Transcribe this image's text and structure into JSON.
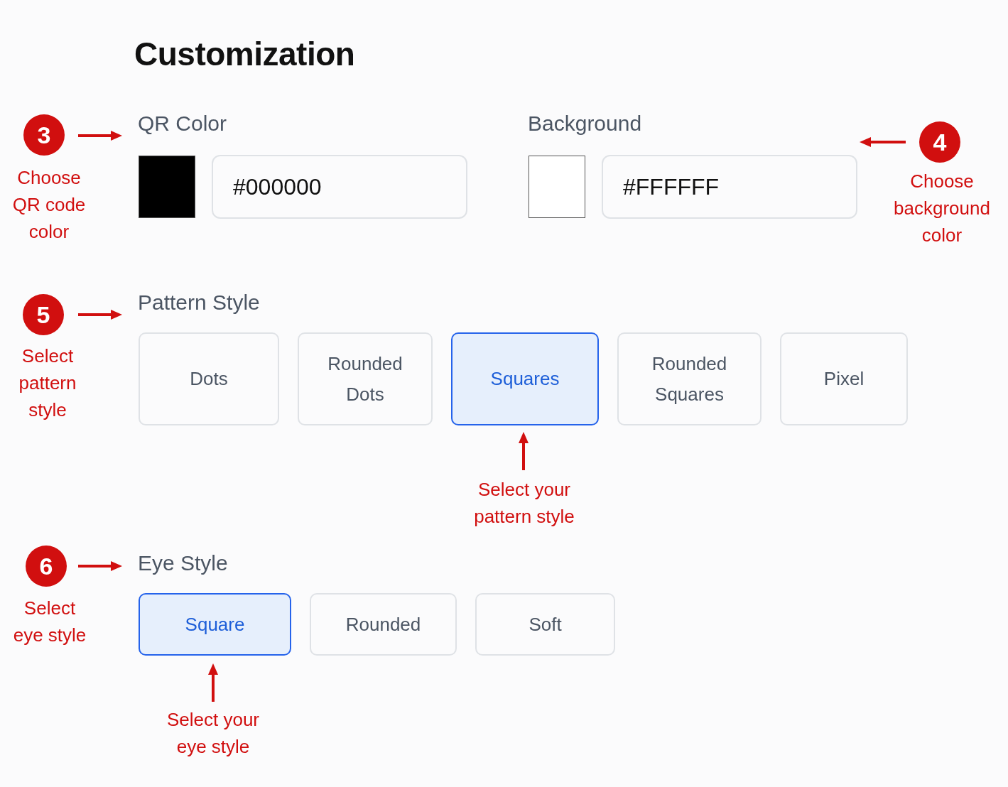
{
  "title": "Customization",
  "colors": [
    {
      "label": "QR Color",
      "value": "#000000"
    },
    {
      "label": "Background",
      "value": "#FFFFFF"
    }
  ],
  "pattern_style": {
    "label": "Pattern Style",
    "options": [
      {
        "label": "Dots",
        "selected": false
      },
      {
        "label": "Rounded\nDots",
        "selected": false
      },
      {
        "label": "Squares",
        "selected": true
      },
      {
        "label": "Rounded\nSquares",
        "selected": false
      },
      {
        "label": "Pixel",
        "selected": false
      }
    ]
  },
  "eye_style": {
    "label": "Eye Style",
    "options": [
      {
        "label": "Square",
        "selected": true
      },
      {
        "label": "Rounded",
        "selected": false
      },
      {
        "label": "Soft",
        "selected": false
      }
    ]
  },
  "annotations": [
    {
      "number": "3",
      "text": "Choose\nQR code\ncolor"
    },
    {
      "number": "4",
      "text": "Choose\nbackground\ncolor"
    },
    {
      "number": "5",
      "text": "Select\npattern\nstyle"
    },
    {
      "number": "6",
      "text": "Select\neye style"
    }
  ],
  "callouts": [
    {
      "text": "Select your\npattern style"
    },
    {
      "text": "Select your\neye style"
    }
  ]
}
